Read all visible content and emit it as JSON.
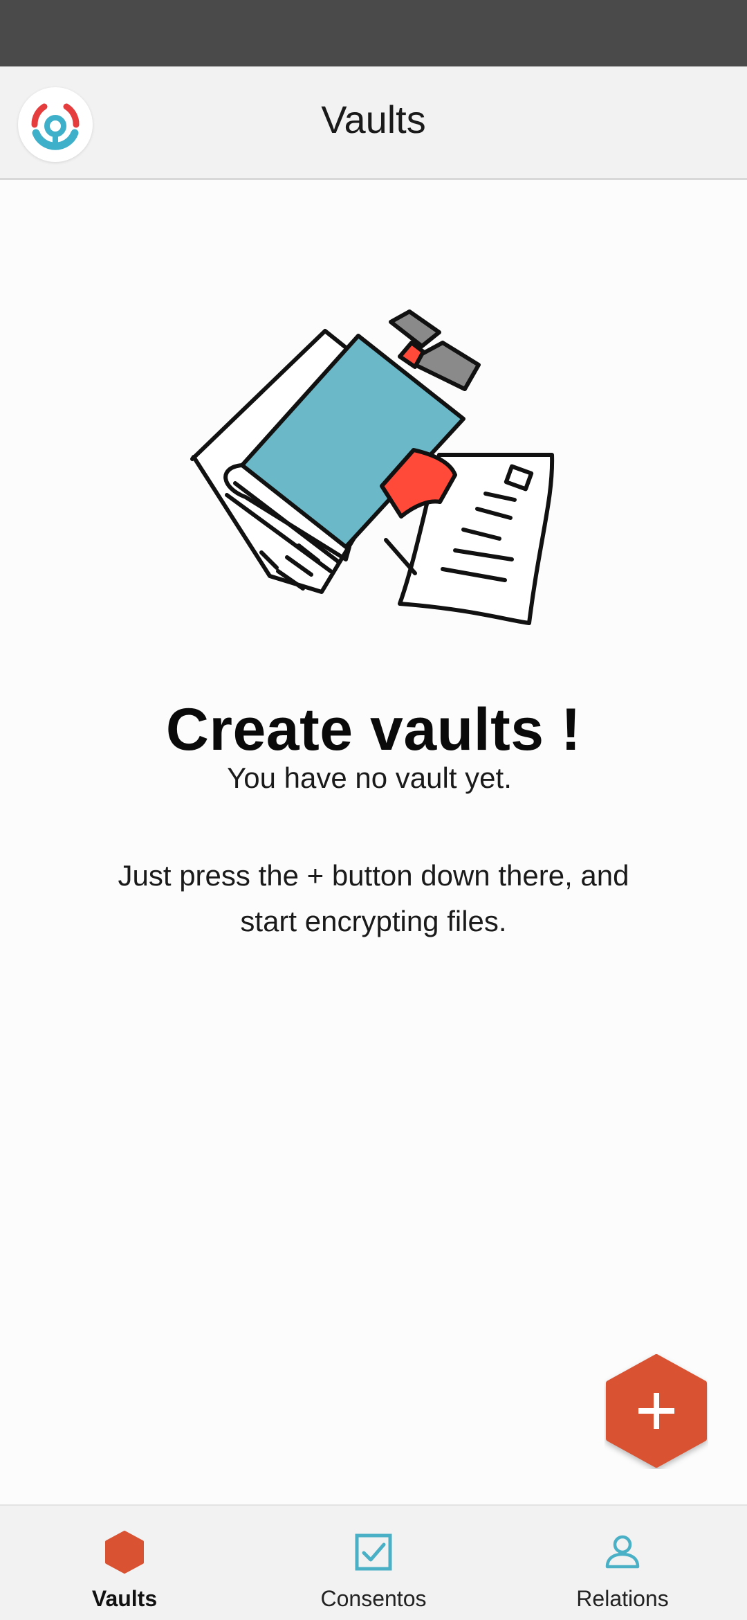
{
  "header": {
    "title": "Vaults",
    "logo_icon": "app-logo-icon"
  },
  "empty_state": {
    "title": "Create vaults !",
    "subtitle": "You have no vault yet.",
    "hint_line1": "Just press the + button down there, and",
    "hint_line2": "start encrypting files.",
    "illustration_icon": "vault-documents-illustration"
  },
  "fab": {
    "icon": "plus-icon",
    "color": "#d95232"
  },
  "bottom_nav": {
    "items": [
      {
        "label": "Vaults",
        "icon": "hexagon-icon",
        "active": true
      },
      {
        "label": "Consentos",
        "icon": "checkbox-icon",
        "active": false
      },
      {
        "label": "Relations",
        "icon": "person-icon",
        "active": false
      }
    ]
  },
  "colors": {
    "accent": "#d95232",
    "teal": "#4ab0c6",
    "logo_red": "#e53d3d",
    "status_bar": "#4a4a4a",
    "app_bar": "#f2f2f2"
  }
}
